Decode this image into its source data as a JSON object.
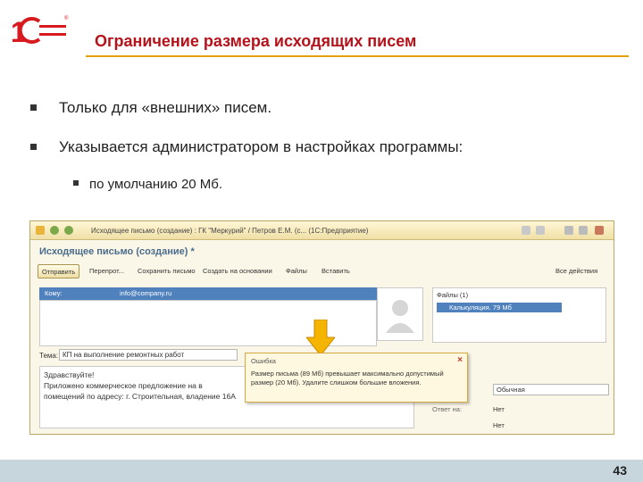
{
  "logo": {
    "text": "1С",
    "brand_color": "#d71920"
  },
  "title": "Ограничение размера исходящих писем",
  "bullets": [
    "Только для «внешних» писем.",
    "Указывается администратором в настройках программы:"
  ],
  "sub_bullets": [
    "по умолчанию 20 Мб."
  ],
  "window": {
    "title": "Исходящее письмо (создание) : ГК \"Меркурий\" / Петров Е.М. (с... (1С:Предприятие)",
    "heading": "Исходящее письмо (создание) *",
    "toolbar": {
      "send": "Отправить",
      "recheck": "Перепрот...",
      "save": "Сохранить письмо",
      "create_based": "Создать на основании",
      "files": "Файлы",
      "insert": "Вставить",
      "all_actions": "Все действия"
    },
    "to_label": "Кому:",
    "to_value": "info@company.ru",
    "files_header": "Файлы (1)",
    "file_name": "Калькуляция. 79 Мб",
    "subject_label": "Тема:",
    "subject_value": "КП на выполнение ремонтных работ",
    "body_lines": [
      "Здравствуйте!",
      "Приложено коммерческое предложение на в",
      "помещений по адресу: г. Строительная, владение 16А"
    ],
    "priority_value": "Обычная",
    "side_labels": [
      "Ответ на:",
      "Нет",
      "Нет"
    ]
  },
  "error_popup": {
    "title": "Ошибка",
    "message": "Размер письма (89 Мб) превышает максимально допустимый размер (20 Мб). Удалите слишком большие вложения."
  },
  "page_number": "43",
  "colors": {
    "title_red": "#b5121b",
    "rule_orange": "#e4a000",
    "selection_blue": "#4f81bd",
    "arrow_yellow": "#f5b400"
  }
}
